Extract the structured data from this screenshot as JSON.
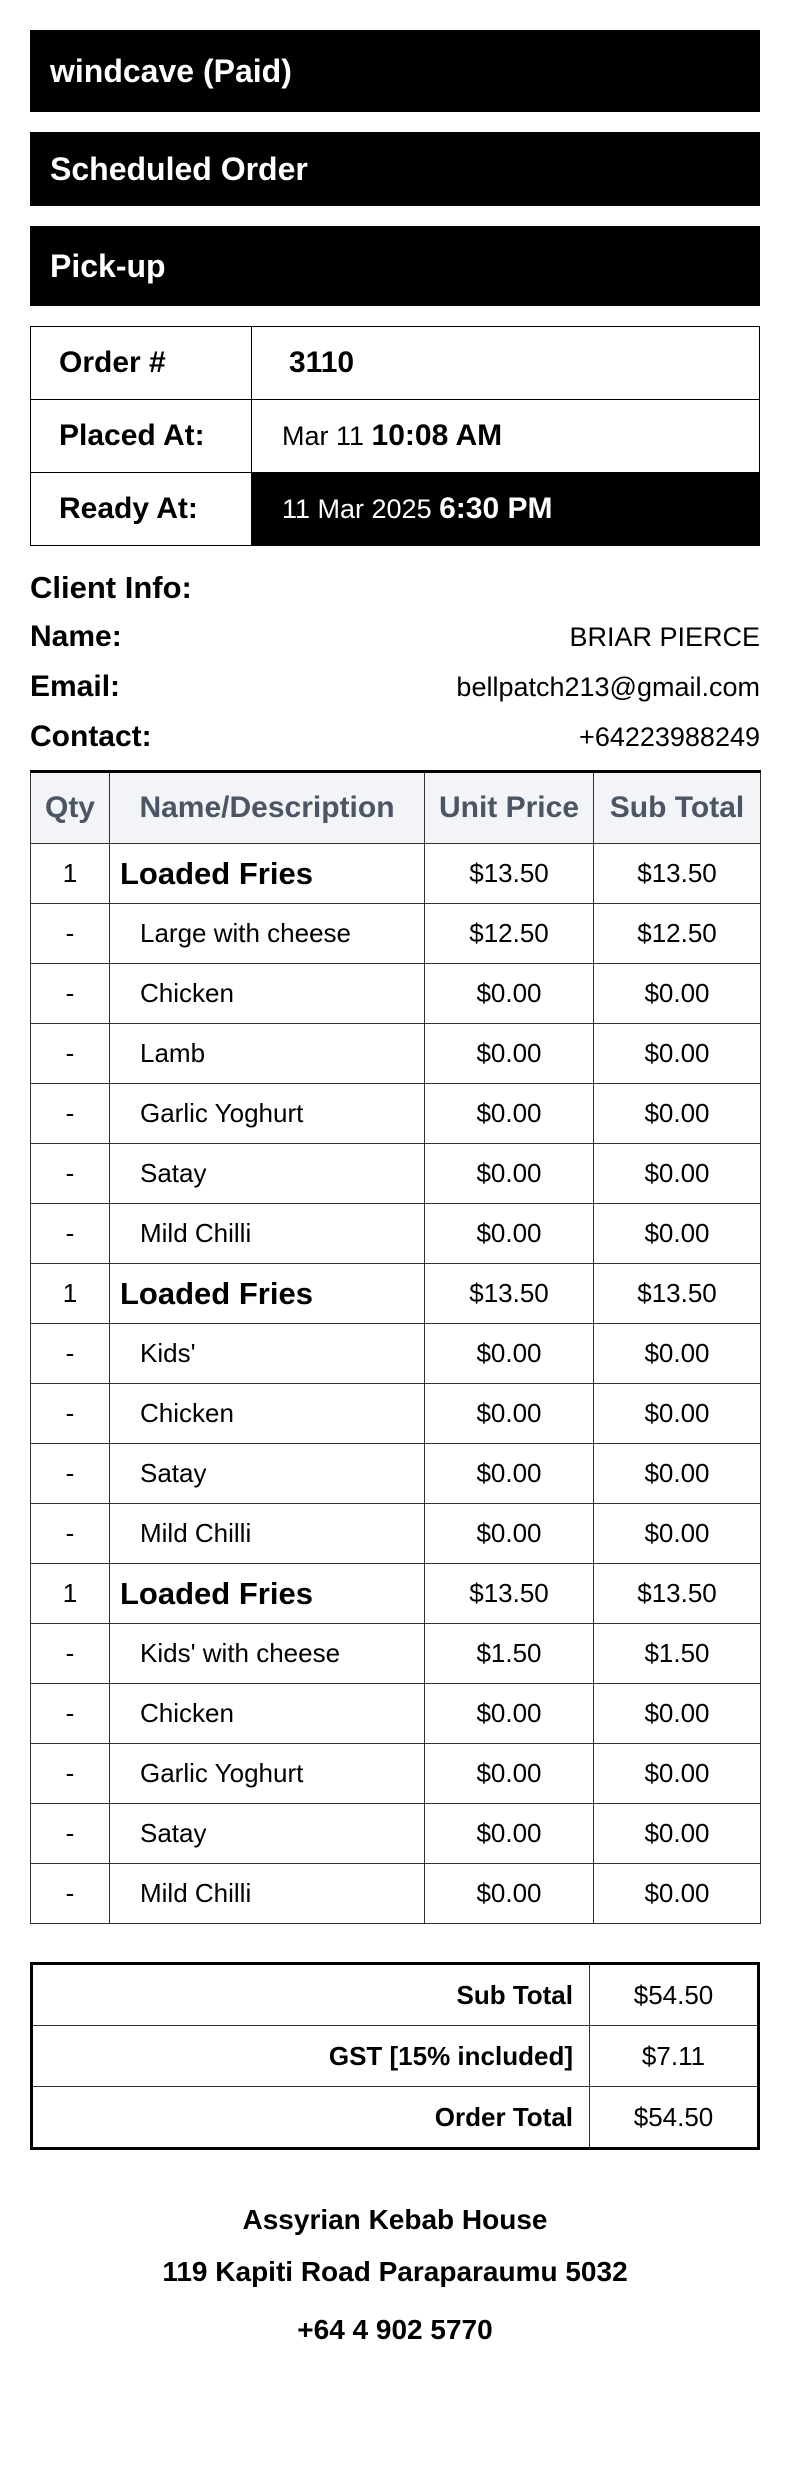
{
  "banners": {
    "payment": "windcave (Paid)",
    "schedule": "Scheduled Order",
    "method": "Pick-up"
  },
  "order": {
    "number_label": "Order #",
    "number": "3110",
    "placed_label": "Placed At:",
    "placed_date": "Mar 11",
    "placed_time": "10:08 AM",
    "ready_label": "Ready At:",
    "ready_date": "11 Mar 2025",
    "ready_time": "6:30 PM"
  },
  "client": {
    "heading": "Client Info:",
    "name_label": "Name:",
    "name": "BRIAR PIERCE",
    "email_label": "Email:",
    "email": "bellpatch213@gmail.com",
    "contact_label": "Contact:",
    "contact": "+64223988249"
  },
  "items": {
    "headers": [
      "Qty",
      "Name/Description",
      "Unit Price",
      "Sub Total"
    ],
    "rows": [
      {
        "qty": "1",
        "name": "Loaded Fries",
        "unit": "$13.50",
        "sub": "$13.50",
        "main": true
      },
      {
        "qty": "-",
        "name": "Large with cheese",
        "unit": "$12.50",
        "sub": "$12.50",
        "main": false
      },
      {
        "qty": "-",
        "name": "Chicken",
        "unit": "$0.00",
        "sub": "$0.00",
        "main": false
      },
      {
        "qty": "-",
        "name": "Lamb",
        "unit": "$0.00",
        "sub": "$0.00",
        "main": false
      },
      {
        "qty": "-",
        "name": "Garlic Yoghurt",
        "unit": "$0.00",
        "sub": "$0.00",
        "main": false
      },
      {
        "qty": "-",
        "name": "Satay",
        "unit": "$0.00",
        "sub": "$0.00",
        "main": false
      },
      {
        "qty": "-",
        "name": "Mild Chilli",
        "unit": "$0.00",
        "sub": "$0.00",
        "main": false
      },
      {
        "qty": "1",
        "name": "Loaded Fries",
        "unit": "$13.50",
        "sub": "$13.50",
        "main": true
      },
      {
        "qty": "-",
        "name": "Kids'",
        "unit": "$0.00",
        "sub": "$0.00",
        "main": false
      },
      {
        "qty": "-",
        "name": "Chicken",
        "unit": "$0.00",
        "sub": "$0.00",
        "main": false
      },
      {
        "qty": "-",
        "name": "Satay",
        "unit": "$0.00",
        "sub": "$0.00",
        "main": false
      },
      {
        "qty": "-",
        "name": "Mild Chilli",
        "unit": "$0.00",
        "sub": "$0.00",
        "main": false
      },
      {
        "qty": "1",
        "name": "Loaded Fries",
        "unit": "$13.50",
        "sub": "$13.50",
        "main": true
      },
      {
        "qty": "-",
        "name": "Kids' with cheese",
        "unit": "$1.50",
        "sub": "$1.50",
        "main": false
      },
      {
        "qty": "-",
        "name": "Chicken",
        "unit": "$0.00",
        "sub": "$0.00",
        "main": false
      },
      {
        "qty": "-",
        "name": "Garlic Yoghurt",
        "unit": "$0.00",
        "sub": "$0.00",
        "main": false
      },
      {
        "qty": "-",
        "name": "Satay",
        "unit": "$0.00",
        "sub": "$0.00",
        "main": false
      },
      {
        "qty": "-",
        "name": "Mild Chilli",
        "unit": "$0.00",
        "sub": "$0.00",
        "main": false
      }
    ]
  },
  "totals": {
    "subtotal_label": "Sub Total",
    "subtotal": "$54.50",
    "gst_label": "GST [15% included]",
    "gst": "$7.11",
    "total_label": "Order Total",
    "total": "$54.50"
  },
  "store": {
    "name": "Assyrian Kebab House",
    "address": "119 Kapiti Road Paraparaumu 5032",
    "phone": "+64 4 902 5770"
  }
}
